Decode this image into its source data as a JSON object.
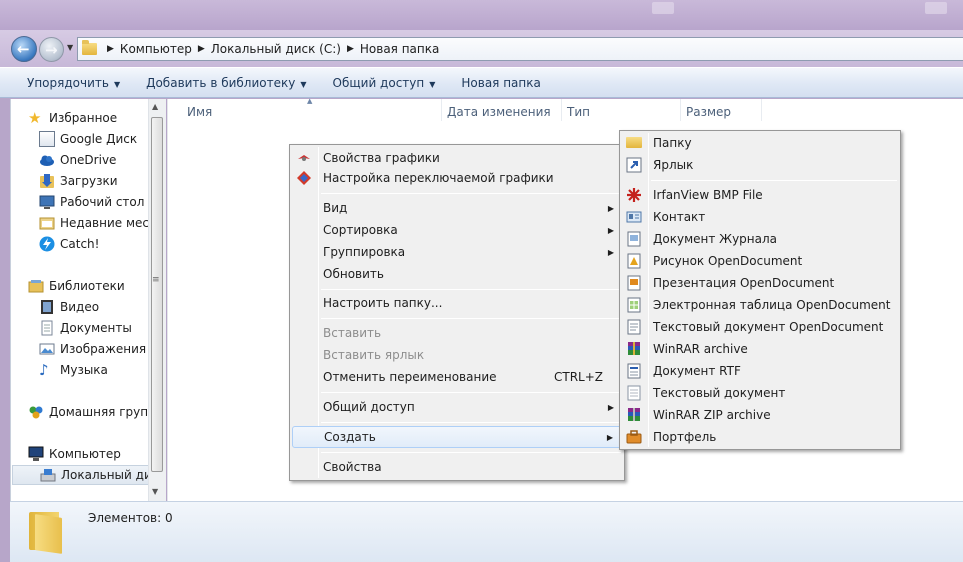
{
  "address": {
    "crumbs": [
      "Компьютер",
      "Локальный диск (C:)",
      "Новая папка"
    ]
  },
  "toolbar": {
    "organize": "Упорядочить",
    "add_library": "Добавить в библиотеку",
    "share": "Общий доступ",
    "new_folder": "Новая папка"
  },
  "nav": {
    "favorites": "Избранное",
    "google_drive": "Google Диск",
    "onedrive": "OneDrive",
    "downloads": "Загрузки",
    "desktop": "Рабочий стол",
    "recent": "Недавние места",
    "catch": "Catch!",
    "libraries": "Библиотеки",
    "video": "Видео",
    "documents": "Документы",
    "pictures": "Изображения",
    "music": "Музыка",
    "homegroup": "Домашняя группа",
    "computer": "Компьютер",
    "local_disk": "Локальный диск"
  },
  "columns": {
    "name": "Имя",
    "modified": "Дата изменения",
    "type": "Тип",
    "size": "Размер"
  },
  "context_menu": {
    "graphics_props": "Свойства графики",
    "switchable_graphics": "Настройка переключаемой графики",
    "view": "Вид",
    "sort": "Сортировка",
    "group": "Группировка",
    "refresh": "Обновить",
    "customize": "Настроить папку...",
    "paste": "Вставить",
    "paste_shortcut": "Вставить ярлык",
    "undo_rename": "Отменить переименование",
    "undo_shortcut": "CTRL+Z",
    "share": "Общий доступ",
    "create": "Создать",
    "properties": "Свойства"
  },
  "create_submenu": {
    "folder": "Папку",
    "shortcut": "Ярлык",
    "irfanview": "IrfanView BMP File",
    "contact": "Контакт",
    "journal": "Документ Журнала",
    "odg": "Рисунок OpenDocument",
    "odp": "Презентация OpenDocument",
    "ods": "Электронная таблица OpenDocument",
    "odt": "Текстовый документ OpenDocument",
    "winrar": "WinRAR archive",
    "rtf": "Документ RTF",
    "txt": "Текстовый документ",
    "winrar_zip": "WinRAR ZIP archive",
    "briefcase": "Портфель"
  },
  "status": {
    "items": "Элементов: 0"
  },
  "colors": {
    "frame": "#c7b8d8",
    "command_text": "#1e395b",
    "menu_bg": "#f0f0f0",
    "highlight_border": "#aecff7"
  }
}
